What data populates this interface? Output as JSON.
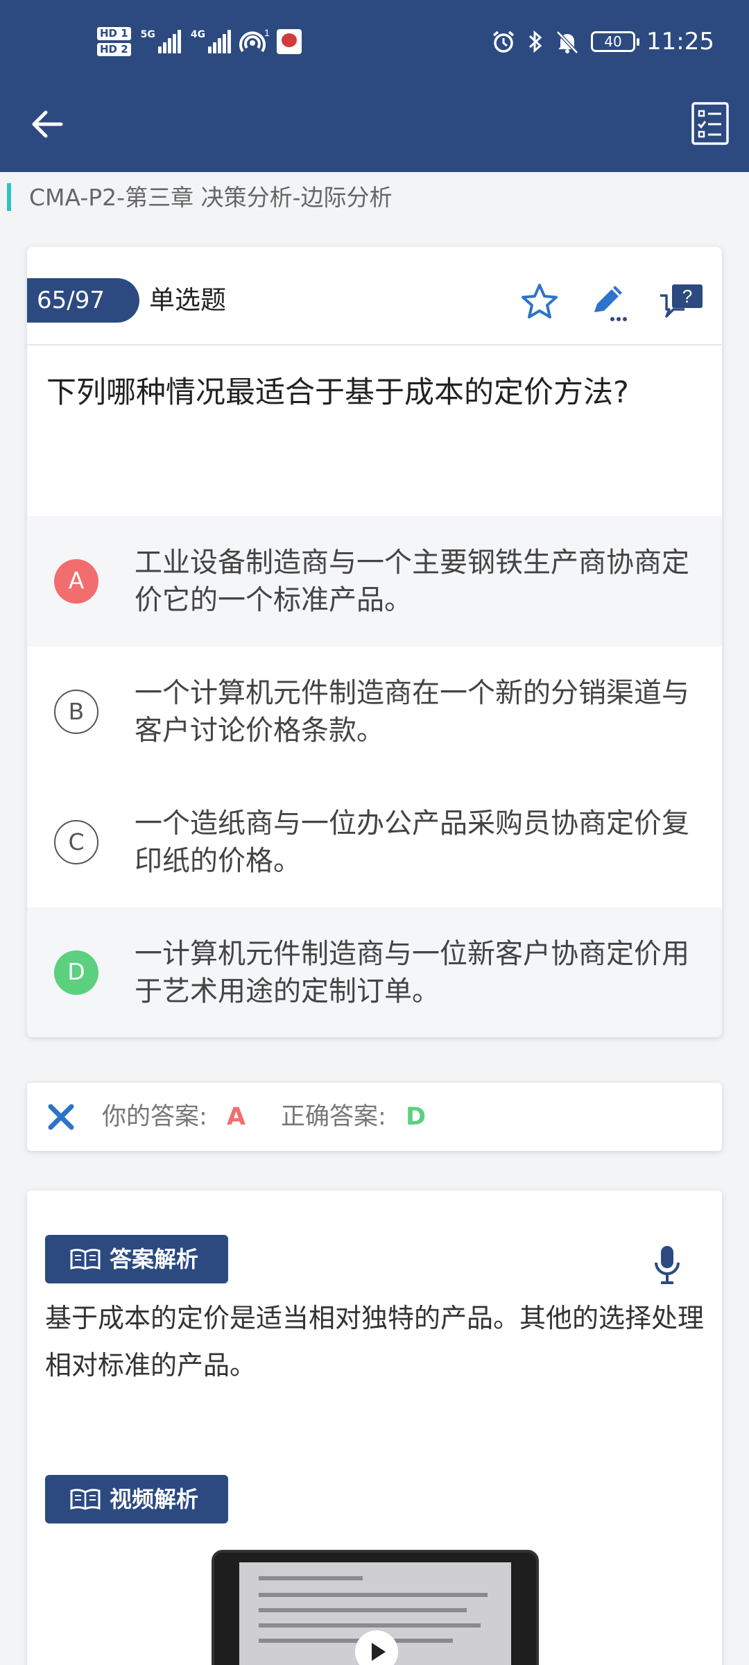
{
  "status_bar": {
    "hd1": "HD 1",
    "hd2": "HD 2",
    "sig1_label": "5G",
    "sig2_label": "4G",
    "hotspot_sup": "1",
    "battery": "40",
    "time": "11:25"
  },
  "breadcrumb": "CMA-P2-第三章  决策分析-边际分析",
  "question": {
    "progress": "65/97",
    "type": "单选题",
    "text": "下列哪种情况最适合于基于成本的定价方法?",
    "options": [
      {
        "letter": "A",
        "text": "工业设备制造商与一个主要钢铁生产商协商定价它的一个标准产品。",
        "state": "wrong"
      },
      {
        "letter": "B",
        "text": "一个计算机元件制造商在一个新的分销渠道与客户讨论价格条款。",
        "state": "normal"
      },
      {
        "letter": "C",
        "text": "一个造纸商与一位办公产品采购员协商定价复印纸的价格。",
        "state": "normal"
      },
      {
        "letter": "D",
        "text": "一计算机元件制造商与一位新客户协商定价用于艺术用途的定制订单。",
        "state": "correct"
      }
    ]
  },
  "result": {
    "your_label": "你的答案:",
    "your_value": "A",
    "correct_label": "正确答案:",
    "correct_value": "D"
  },
  "analysis": {
    "answer_title": "答案解析",
    "answer_text": "基于成本的定价是适当相对独特的产品。其他的选择处理相对标准的产品。",
    "video_title": "视频解析"
  },
  "colors": {
    "primary": "#2c4a80",
    "accent_teal": "#2ec2c4",
    "wrong": "#f26d6d",
    "correct": "#5bd07f",
    "icon_blue": "#2d73c9"
  }
}
